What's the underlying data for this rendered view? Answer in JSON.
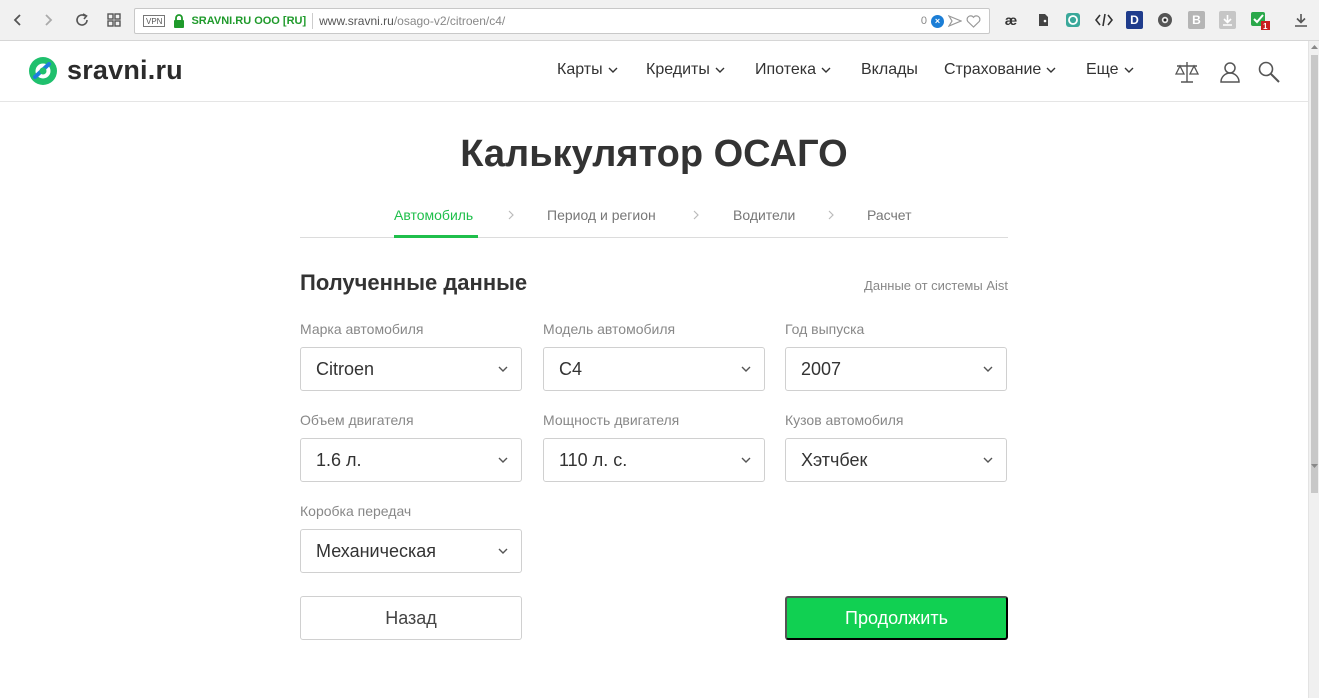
{
  "browser": {
    "vpn_label": "VPN",
    "secure_label": "SRAVNI.RU OOO [RU]",
    "url_host": "www.sravni.ru",
    "url_path": "/osago-v2/citroen/c4/",
    "block_count": "0",
    "ext_ae": "æ",
    "ext_d": "D",
    "ext_b": "B",
    "ext_badge": "1"
  },
  "site": {
    "logo_text": "sravni.ru",
    "menu": [
      {
        "label": "Карты"
      },
      {
        "label": "Кредиты"
      },
      {
        "label": "Ипотека"
      },
      {
        "label": "Вклады"
      },
      {
        "label": "Страхование"
      },
      {
        "label": "Еще"
      }
    ]
  },
  "page": {
    "title": "Калькулятор ОСАГО",
    "steps": [
      {
        "label": "Автомобиль"
      },
      {
        "label": "Период и регион"
      },
      {
        "label": "Водители"
      },
      {
        "label": "Расчет"
      }
    ],
    "section_title": "Полученные данные",
    "source_note": "Данные от системы Aist",
    "fields": {
      "brand": {
        "label": "Марка автомобиля",
        "value": "Citroen"
      },
      "model": {
        "label": "Модель автомобиля",
        "value": "C4"
      },
      "year": {
        "label": "Год выпуска",
        "value": "2007"
      },
      "engine_volume": {
        "label": "Объем двигателя",
        "value": "1.6 л."
      },
      "engine_power": {
        "label": "Мощность двигателя",
        "value": "110 л. с."
      },
      "body": {
        "label": "Кузов автомобиля",
        "value": "Хэтчбек"
      },
      "gearbox": {
        "label": "Коробка передач",
        "value": "Механическая"
      }
    },
    "back_label": "Назад",
    "next_label": "Продолжить"
  },
  "colors": {
    "accent": "#1fbf4b",
    "button_green": "#11d052",
    "secure_green": "#1f9a2b"
  }
}
